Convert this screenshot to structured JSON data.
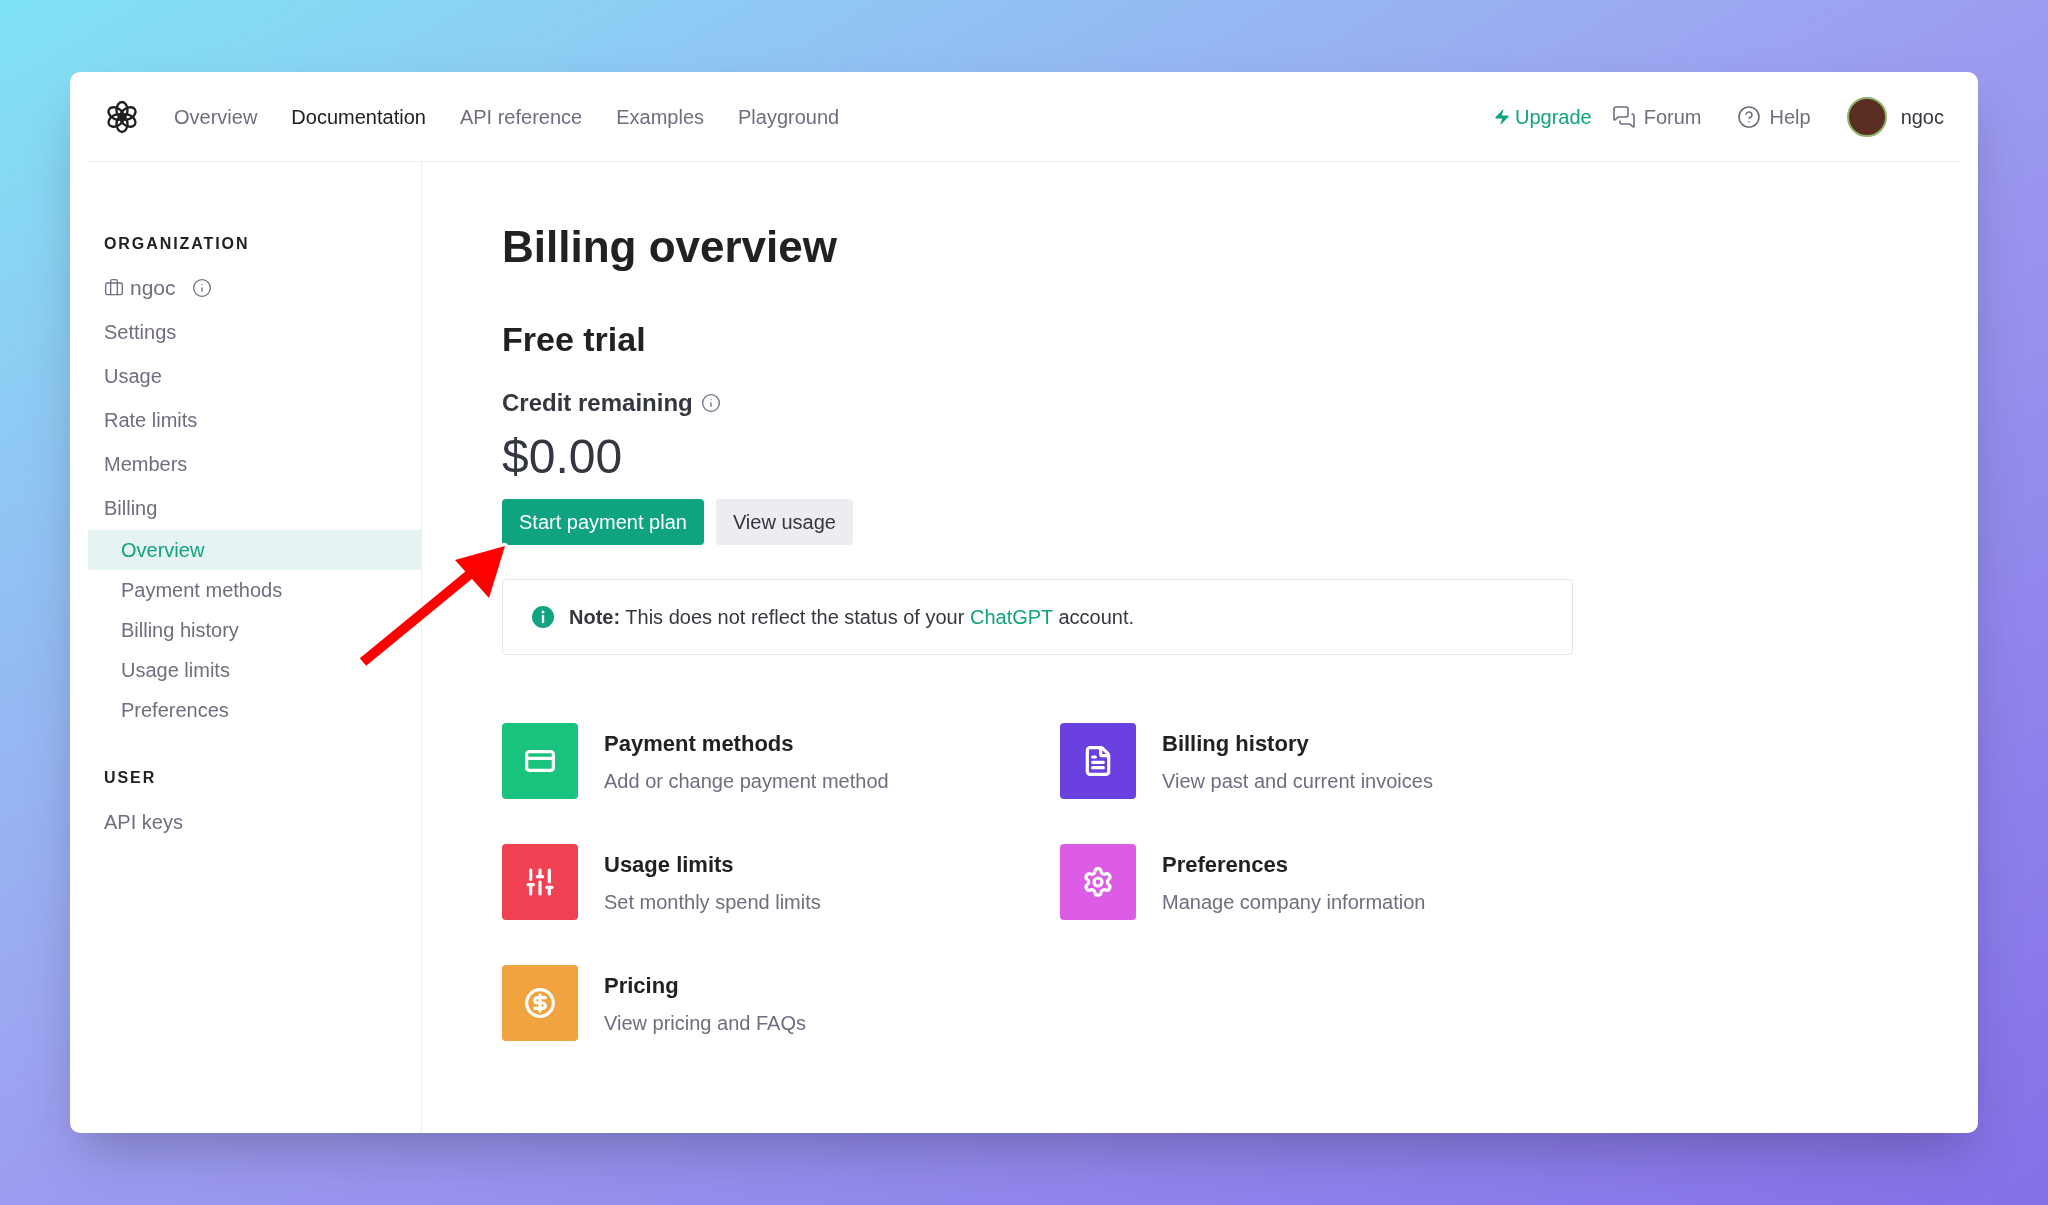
{
  "nav": {
    "links": [
      {
        "label": "Overview",
        "selected": false
      },
      {
        "label": "Documentation",
        "selected": true
      },
      {
        "label": "API reference",
        "selected": false
      },
      {
        "label": "Examples",
        "selected": false
      },
      {
        "label": "Playground",
        "selected": false
      }
    ],
    "upgrade": "Upgrade",
    "forum": "Forum",
    "help": "Help",
    "user": "ngoc"
  },
  "sidebar": {
    "sections": [
      {
        "title": "ORGANIZATION",
        "org": "ngoc",
        "items": [
          {
            "label": "Settings",
            "selected": false
          },
          {
            "label": "Usage",
            "selected": false
          },
          {
            "label": "Rate limits",
            "selected": false
          },
          {
            "label": "Members",
            "selected": false
          },
          {
            "label": "Billing",
            "selected": false,
            "children": [
              {
                "label": "Overview",
                "selected": true
              },
              {
                "label": "Payment methods",
                "selected": false
              },
              {
                "label": "Billing history",
                "selected": false
              },
              {
                "label": "Usage limits",
                "selected": false
              },
              {
                "label": "Preferences",
                "selected": false
              }
            ]
          }
        ]
      },
      {
        "title": "USER",
        "items": [
          {
            "label": "API keys",
            "selected": false
          }
        ]
      }
    ]
  },
  "main": {
    "title": "Billing overview",
    "plan": "Free trial",
    "credit_label": "Credit remaining",
    "credit": "$0.00",
    "buttons": [
      {
        "label": "Start payment plan",
        "kind": "primary"
      },
      {
        "label": "View usage",
        "kind": "secondary"
      }
    ],
    "note": {
      "label": "Note:",
      "before": "This does not reflect the status of your",
      "link": "ChatGPT",
      "after": "account."
    },
    "tiles": [
      {
        "title": "Payment methods",
        "subtitle": "Add or change payment method",
        "kind": "card",
        "color": "#19c37d"
      },
      {
        "title": "Billing history",
        "subtitle": "View past and current invoices",
        "kind": "document",
        "color": "#6b40e0"
      },
      {
        "title": "Usage limits",
        "subtitle": "Set monthly spend limits",
        "kind": "sliders",
        "color": "#ef4152"
      },
      {
        "title": "Preferences",
        "subtitle": "Manage company information",
        "kind": "gear",
        "color": "#dd5ce5"
      },
      {
        "title": "Pricing",
        "subtitle": "View pricing and FAQs",
        "kind": "dollar",
        "color": "#f0a33e"
      }
    ]
  }
}
